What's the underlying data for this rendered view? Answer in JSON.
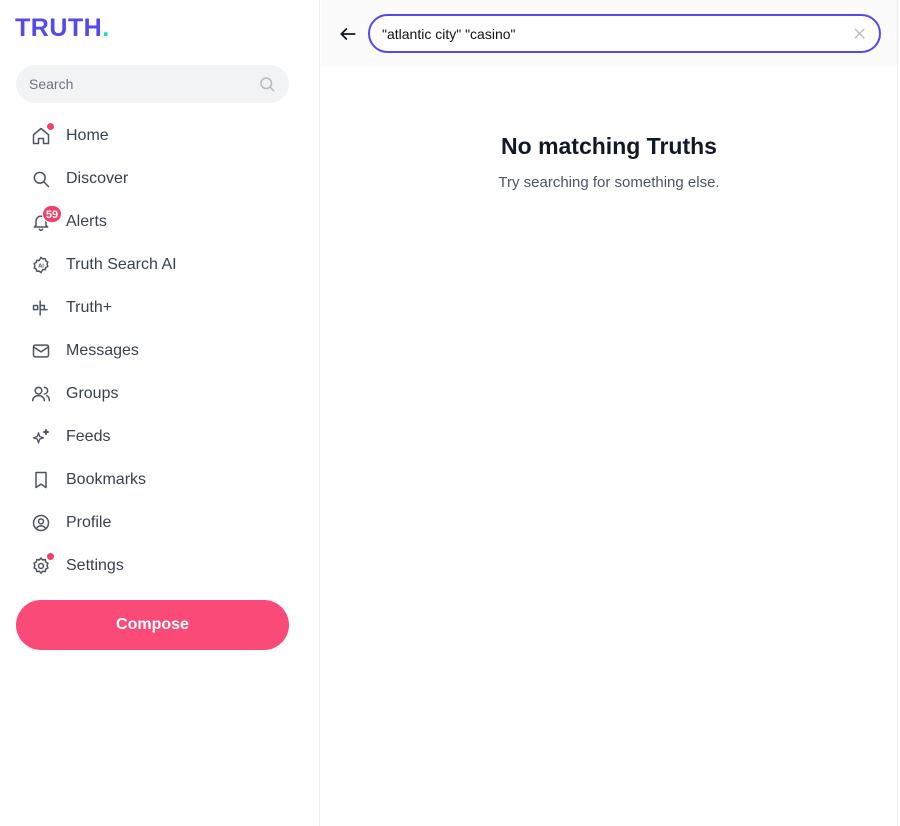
{
  "brand": {
    "logo_text": "TRUTH",
    "logo_dot": ".",
    "accent": "#5448ee",
    "dot_color": "#17e0c4"
  },
  "sidebar": {
    "search_placeholder": "Search",
    "items": [
      {
        "label": "Home",
        "icon": "home-icon",
        "indicator": "dot"
      },
      {
        "label": "Discover",
        "icon": "search-icon"
      },
      {
        "label": "Alerts",
        "icon": "bell-icon",
        "badge": "59"
      },
      {
        "label": "Truth Search AI",
        "icon": "ai-icon"
      },
      {
        "label": "Truth+",
        "icon": "truth-plus-icon"
      },
      {
        "label": "Messages",
        "icon": "mail-icon"
      },
      {
        "label": "Groups",
        "icon": "users-icon"
      },
      {
        "label": "Feeds",
        "icon": "sparkles-icon"
      },
      {
        "label": "Bookmarks",
        "icon": "bookmark-icon"
      },
      {
        "label": "Profile",
        "icon": "profile-icon"
      },
      {
        "label": "Settings",
        "icon": "gear-icon",
        "indicator": "dot"
      }
    ],
    "compose_label": "Compose",
    "compose_color": "#fa4a77",
    "badge_color": "#f0416b"
  },
  "topbar": {
    "search_value": "\"atlantic city\" \"casino\""
  },
  "results": {
    "empty_title": "No matching Truths",
    "empty_subtitle": "Try searching for something else."
  }
}
